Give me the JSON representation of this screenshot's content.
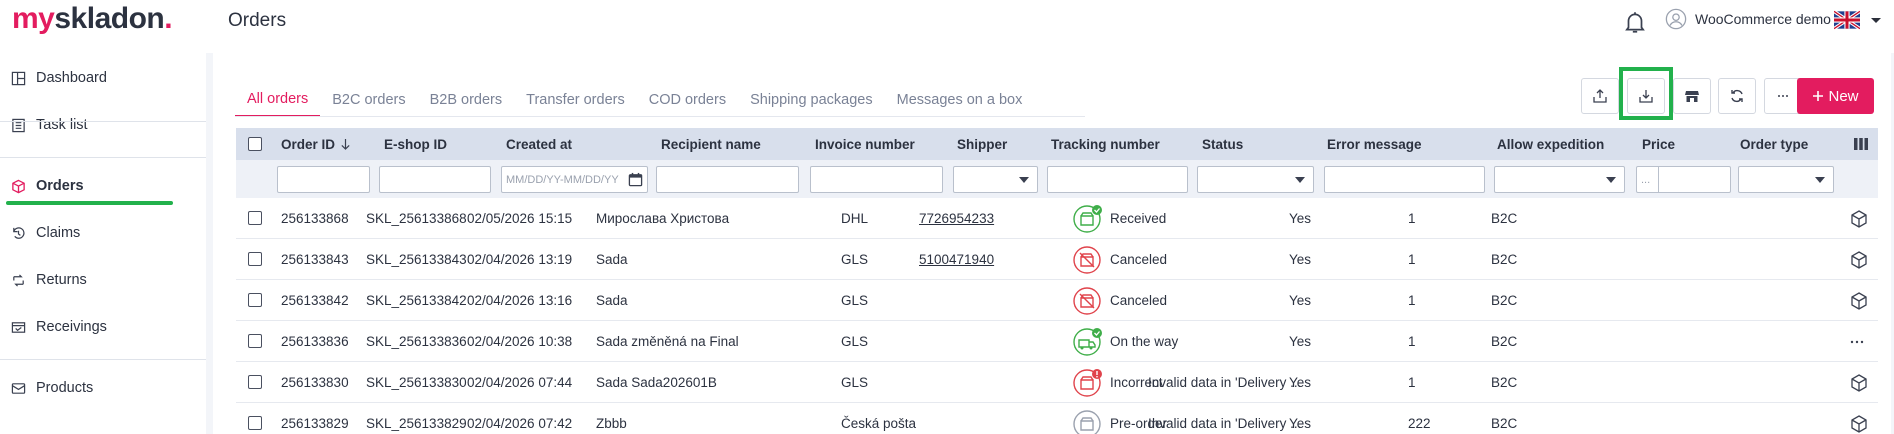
{
  "app": {
    "logo_my": "my",
    "logo_rest": "skladon",
    "logo_dot": ".",
    "page_title": "Orders",
    "user_name": "WooCommerce demo",
    "accent": "#e31c5f",
    "highlight_color": "#22b14c"
  },
  "sidebar": {
    "items": [
      {
        "label": "Dashboard",
        "icon": "dashboard-icon"
      },
      {
        "label": "Task list",
        "icon": "task-list-icon"
      },
      {
        "label": "Orders",
        "icon": "box-icon"
      },
      {
        "label": "Claims",
        "icon": "claims-icon"
      },
      {
        "label": "Returns",
        "icon": "returns-icon"
      },
      {
        "label": "Receivings",
        "icon": "receivings-icon"
      },
      {
        "label": "Products",
        "icon": "products-icon"
      }
    ]
  },
  "tabs": [
    "All orders",
    "B2C orders",
    "B2B orders",
    "Transfer orders",
    "COD orders",
    "Shipping packages",
    "Messages on a box"
  ],
  "toolbar": {
    "new_label": "New",
    "icons": [
      "export-icon",
      "import-icon",
      "store-icon",
      "refresh-icon",
      "more-icon"
    ]
  },
  "table": {
    "columns": [
      "Order ID",
      "E-shop ID",
      "Created at",
      "Recipient name",
      "Invoice number",
      "Shipper",
      "Tracking number",
      "Status",
      "Error message",
      "Allow expedition",
      "Price",
      "Order type"
    ],
    "date_placeholder": "MM/DD/YY-MM/DD/YY",
    "price_prefix": "...",
    "rows": [
      {
        "order_id": "256133868",
        "eshop_id": "SKL_256133868",
        "created": "02/05/2026 15:15",
        "recipient": "Мирослава Христова",
        "invoice": "",
        "shipper": "DHL",
        "tracking": "7726954233",
        "status": "Received",
        "status_kind": "received",
        "error": "",
        "allow": "Yes",
        "price": "1",
        "type": "B2C",
        "action": "cube-icon"
      },
      {
        "order_id": "256133843",
        "eshop_id": "SKL_256133843",
        "created": "02/04/2026 13:19",
        "recipient": "Sada",
        "invoice": "",
        "shipper": "GLS",
        "tracking": "5100471940",
        "status": "Canceled",
        "status_kind": "canceled",
        "error": "",
        "allow": "Yes",
        "price": "1",
        "type": "B2C",
        "action": "cube-icon"
      },
      {
        "order_id": "256133842",
        "eshop_id": "SKL_256133842",
        "created": "02/04/2026 13:16",
        "recipient": "Sada",
        "invoice": "",
        "shipper": "GLS",
        "tracking": "",
        "status": "Canceled",
        "status_kind": "canceled",
        "error": "",
        "allow": "Yes",
        "price": "1",
        "type": "B2C",
        "action": "cube-icon"
      },
      {
        "order_id": "256133836",
        "eshop_id": "SKL_256133836",
        "created": "02/04/2026 10:38",
        "recipient": "Sada změněná na Final",
        "invoice": "",
        "shipper": "GLS",
        "tracking": "",
        "status": "On the way",
        "status_kind": "ontheway",
        "error": "",
        "allow": "Yes",
        "price": "1",
        "type": "B2C",
        "action": "more-icon"
      },
      {
        "order_id": "256133830",
        "eshop_id": "SKL_256133830",
        "created": "02/04/2026 07:44",
        "recipient": "Sada Sada202601B",
        "invoice": "",
        "shipper": "GLS",
        "tracking": "",
        "status": "Incorrect",
        "status_kind": "incorrect",
        "error": "Invalid data in 'Delivery ...",
        "allow": "Yes",
        "price": "1",
        "type": "B2C",
        "action": "cube-icon"
      },
      {
        "order_id": "256133829",
        "eshop_id": "SKL_256133829",
        "created": "02/04/2026 07:42",
        "recipient": "Zbbb",
        "invoice": "",
        "shipper": "Česká pošta",
        "tracking": "",
        "status": "Pre-order",
        "status_kind": "preorder",
        "error": "Invalid data in 'Delivery ...",
        "allow": "Yes",
        "price": "222",
        "type": "B2C",
        "action": "cube-icon"
      }
    ]
  }
}
